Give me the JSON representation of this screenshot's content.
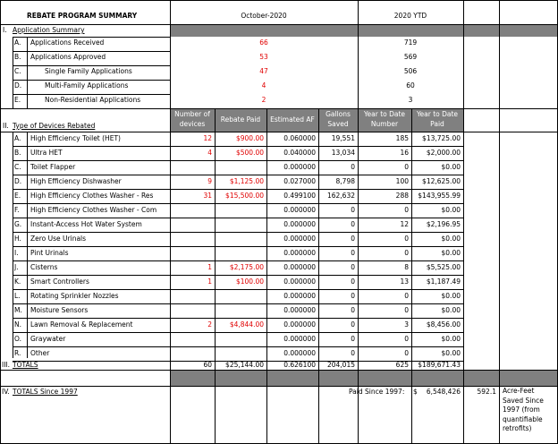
{
  "title": "REBATE PROGRAM SUMMARY",
  "period_label": "October-2020",
  "ytd_label": "2020 YTD",
  "section1": {
    "roman": "I.",
    "title": "Application Summary",
    "rows": [
      {
        "letter": "A.",
        "label": "Applications Received",
        "month": "66",
        "ytd": "719"
      },
      {
        "letter": "B.",
        "label": "Applications Approved",
        "month": "53",
        "ytd": "569"
      },
      {
        "letter": "C.",
        "label": "Single Family Applications",
        "month": "47",
        "ytd": "506"
      },
      {
        "letter": "D.",
        "label": "Multi-Family Applications",
        "month": "4",
        "ytd": "60"
      },
      {
        "letter": "E.",
        "label": "Non-Residential Applications",
        "month": "2",
        "ytd": "3"
      }
    ]
  },
  "section2": {
    "roman": "II.",
    "title": "Type of Devices Rebated",
    "headers": {
      "devices": "Number of devices",
      "rebate": "Rebate Paid",
      "af": "Estimated AF",
      "gallons": "Gallons Saved",
      "ytd_number": "Year to Date Number",
      "ytd_paid": "Year to Date Paid"
    },
    "rows": [
      {
        "letter": "A.",
        "label": "High Efficiency Toilet (HET)",
        "devices": "12",
        "rebate": "$900.00",
        "af": "0.060000",
        "gallons": "19,551",
        "ytdn": "185",
        "ytdp": "$13,725.00"
      },
      {
        "letter": "B.",
        "label": "Ultra HET",
        "devices": "4",
        "rebate": "$500.00",
        "af": "0.040000",
        "gallons": "13,034",
        "ytdn": "16",
        "ytdp": "$2,000.00"
      },
      {
        "letter": "C.",
        "label": "Toilet Flapper",
        "devices": "",
        "rebate": "",
        "af": "0.000000",
        "gallons": "0",
        "ytdn": "0",
        "ytdp": "$0.00"
      },
      {
        "letter": "D.",
        "label": "High Efficiency Dishwasher",
        "devices": "9",
        "rebate": "$1,125.00",
        "af": "0.027000",
        "gallons": "8,798",
        "ytdn": "100",
        "ytdp": "$12,625.00"
      },
      {
        "letter": "E.",
        "label": "High Efficiency Clothes Washer - Res",
        "devices": "31",
        "rebate": "$15,500.00",
        "af": "0.499100",
        "gallons": "162,632",
        "ytdn": "288",
        "ytdp": "$143,955.99"
      },
      {
        "letter": "F.",
        "label": "High Efficiency Clothes Washer - Com",
        "devices": "",
        "rebate": "",
        "af": "0.000000",
        "gallons": "0",
        "ytdn": "0",
        "ytdp": "$0.00"
      },
      {
        "letter": "G.",
        "label": "Instant-Access Hot Water System",
        "devices": "",
        "rebate": "",
        "af": "0.000000",
        "gallons": "0",
        "ytdn": "12",
        "ytdp": "$2,196.95"
      },
      {
        "letter": "H.",
        "label": "Zero Use Urinals",
        "devices": "",
        "rebate": "",
        "af": "0.000000",
        "gallons": "0",
        "ytdn": "0",
        "ytdp": "$0.00"
      },
      {
        "letter": "I.",
        "label": "Pint Urinals",
        "devices": "",
        "rebate": "",
        "af": "0.000000",
        "gallons": "0",
        "ytdn": "0",
        "ytdp": "$0.00"
      },
      {
        "letter": "J.",
        "label": "Cisterns",
        "devices": "1",
        "rebate": "$2,175.00",
        "af": "0.000000",
        "gallons": "0",
        "ytdn": "8",
        "ytdp": "$5,525.00"
      },
      {
        "letter": "K.",
        "label": "Smart Controllers",
        "devices": "1",
        "rebate": "$100.00",
        "af": "0.000000",
        "gallons": "0",
        "ytdn": "13",
        "ytdp": "$1,187.49"
      },
      {
        "letter": "L.",
        "label": "Rotating Sprinkler Nozzles",
        "devices": "",
        "rebate": "",
        "af": "0.000000",
        "gallons": "0",
        "ytdn": "0",
        "ytdp": "$0.00"
      },
      {
        "letter": "M.",
        "label": "Moisture Sensors",
        "devices": "",
        "rebate": "",
        "af": "0.000000",
        "gallons": "0",
        "ytdn": "0",
        "ytdp": "$0.00"
      },
      {
        "letter": "N.",
        "label": "Lawn Removal & Replacement",
        "devices": "2",
        "rebate": "$4,844.00",
        "af": "0.000000",
        "gallons": "0",
        "ytdn": "3",
        "ytdp": "$8,456.00"
      },
      {
        "letter": "O.",
        "label": "Graywater",
        "devices": "",
        "rebate": "",
        "af": "0.000000",
        "gallons": "0",
        "ytdn": "0",
        "ytdp": "$0.00"
      },
      {
        "letter": "R.",
        "label": "Other",
        "devices": "",
        "rebate": "",
        "af": "0.000000",
        "gallons": "0",
        "ytdn": "0",
        "ytdp": "$0.00"
      }
    ]
  },
  "section3": {
    "roman": "III.",
    "title": "TOTALS",
    "devices": "60",
    "rebate": "$25,144.00",
    "af": "0.626100",
    "gallons": "204,015",
    "ytdn": "625",
    "ytdp": "$189,671.43"
  },
  "section4": {
    "roman": "IV.",
    "title": "TOTALS Since 1997",
    "paid_label": "Paid Since 1997:",
    "paid_currency": "$",
    "paid_value": "6,548,426",
    "acre_feet": "592.1",
    "acre_feet_label": "Acre-Feet Saved Since 1997 (from quantifiable retrofits)"
  }
}
